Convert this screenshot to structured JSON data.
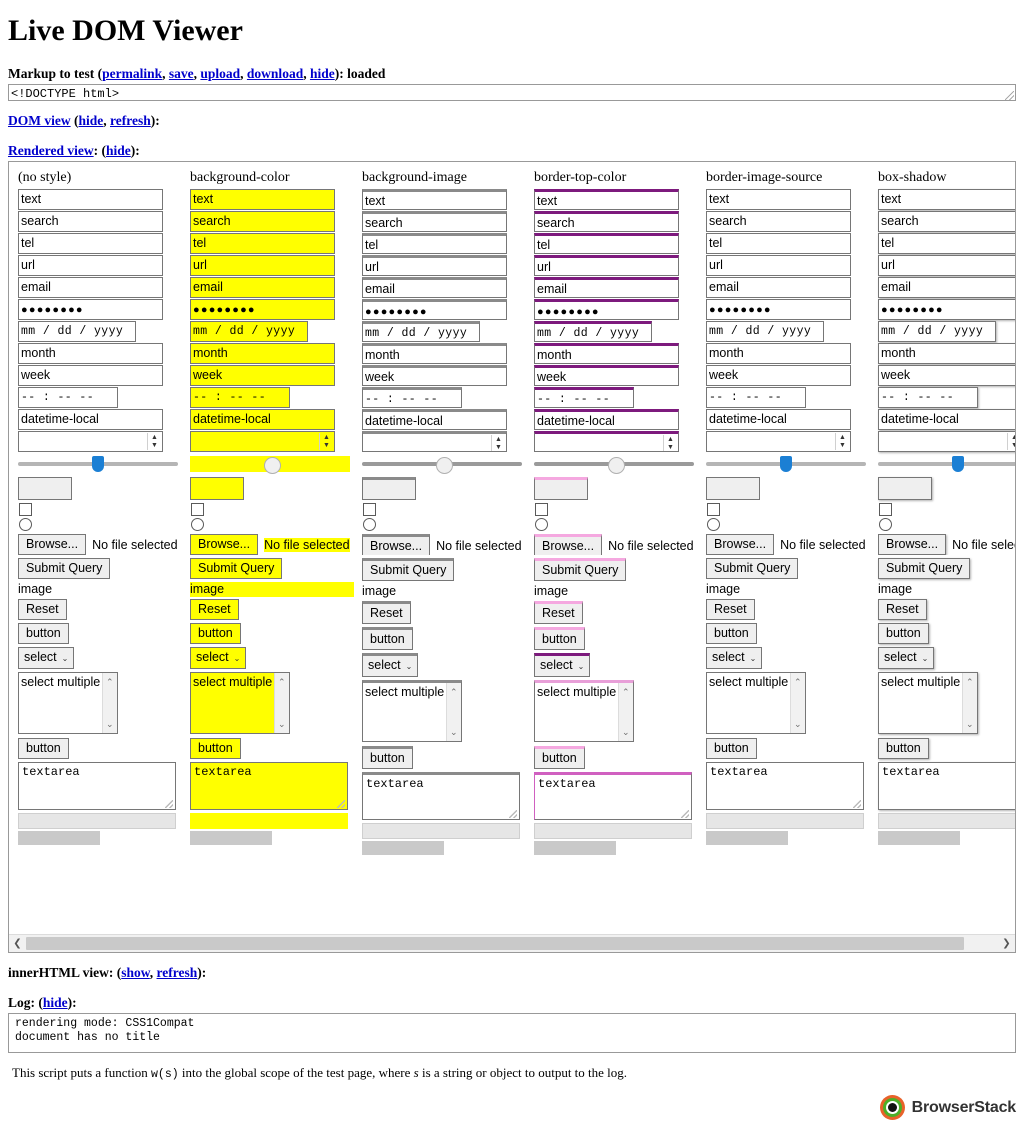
{
  "page": {
    "title": "Live DOM Viewer"
  },
  "markup": {
    "label_prefix": "Markup to test (",
    "links": [
      {
        "label": "permalink"
      },
      {
        "label": "save"
      },
      {
        "label": "upload"
      },
      {
        "label": "download"
      },
      {
        "label": "hide"
      }
    ],
    "label_suffix": "): ",
    "status": "loaded",
    "value": "<!DOCTYPE html>"
  },
  "dom_view": {
    "link": "DOM view",
    "open_paren": " (",
    "hide": "hide",
    "comma": ", ",
    "refresh": "refresh",
    "close_paren": "):"
  },
  "rendered_view": {
    "link": "Rendered view",
    "mid": ": (",
    "hide": "hide",
    "close_paren": "):"
  },
  "innerhtml_view": {
    "label": "innerHTML view: (",
    "show": "show",
    "comma": ", ",
    "refresh": "refresh",
    "close_paren": "):"
  },
  "log": {
    "label": "Log: (",
    "hide": "hide",
    "close_paren": "):",
    "lines": [
      "rendering mode: CSS1Compat",
      "document has no title"
    ]
  },
  "footer": {
    "note_part1": "This script puts a function ",
    "note_fn": "w(s)",
    "note_part2": " into the global scope of the test page, where ",
    "note_var": "s",
    "note_part3": " is a string or object to output to the log.",
    "brand": "BrowserStack"
  },
  "colors": {
    "link": "#0000cc",
    "highlight_yellow": "#ffff00",
    "border_purple": "#7d1a7d",
    "border_pink": "#f5a8e0",
    "slider_blue": "#1b7fd4",
    "progress_green": "#0a9b2e",
    "progress_blue": "#1268b3",
    "meter_olive": "#86b62e",
    "brand_orange": "#e8622a",
    "brand_green": "#4caf28"
  },
  "controls": {
    "text": "text",
    "search": "search",
    "tel": "tel",
    "url": "url",
    "email": "email",
    "password": "●●●●●●●●",
    "date": "mm / dd / yyyy",
    "month": "month",
    "week": "week",
    "time": "-- : --   --",
    "datetime_local": "datetime-local",
    "number": "",
    "browse": "Browse...",
    "file_status": "No file selected",
    "submit": "Submit Query",
    "image": "image",
    "reset": "Reset",
    "button": "button",
    "select": "select",
    "select_multiple": "select multiple",
    "button2": "button",
    "textarea": "textarea"
  },
  "columns": [
    {
      "title": "(no style)",
      "variant": "v-none"
    },
    {
      "title": "background-color",
      "variant": "v-bg"
    },
    {
      "title": "background-image",
      "variant": "v-bgi"
    },
    {
      "title": "border-top-color",
      "variant": "v-btc"
    },
    {
      "title": "border-image-source",
      "variant": "v-bis"
    },
    {
      "title": "box-shadow",
      "variant": "v-bsh"
    }
  ]
}
